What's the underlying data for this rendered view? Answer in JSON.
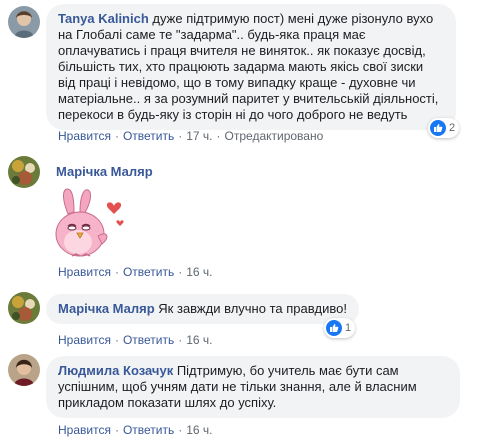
{
  "colors": {
    "link": "#385898",
    "bubble": "#f2f3f5",
    "like": "#1877f2",
    "meta": "#606770"
  },
  "comments": [
    {
      "author": "Tanya Kalinich",
      "text": "дуже підтримую пост) мені дуже різонуло вухо на Глобалі саме те \"задарма\".. будь-яка праця має оплачуватись і праця вчителя не виняток.. як показує досвід, більшість тих, хто працюють задарма мають якісь свої зиски від праці і невідомо, що в тому випадку краще - духовне чи матеріальне.. я за розумний паритет у вчительській діяльності, перекоси в будь-яку із сторін ні до чого доброго не ведуть",
      "like": "Нравится",
      "reply": "Ответить",
      "time": "17 ч.",
      "edited": "Отредактировано",
      "reactions": "2",
      "reaction_icon": "thumbs-up-icon"
    },
    {
      "author": "Марічка Маляр",
      "sticker": "pink-bird-heart-sticker",
      "like": "Нравится",
      "reply": "Ответить",
      "time": "16 ч."
    },
    {
      "author": "Марічка Маляр",
      "text": "Як завжди влучно та правдиво!",
      "like": "Нравится",
      "reply": "Ответить",
      "time": "16 ч.",
      "reactions": "1",
      "reaction_icon": "thumbs-up-icon"
    },
    {
      "author": "Людмила Козачук",
      "text": "Підтримую, бо учитель має бути сам успішним, щоб учням дати не тільки знання, але й власним прикладом показати шлях до успіху.",
      "like": "Нравится",
      "reply": "Ответить",
      "time": "16 ч."
    }
  ]
}
